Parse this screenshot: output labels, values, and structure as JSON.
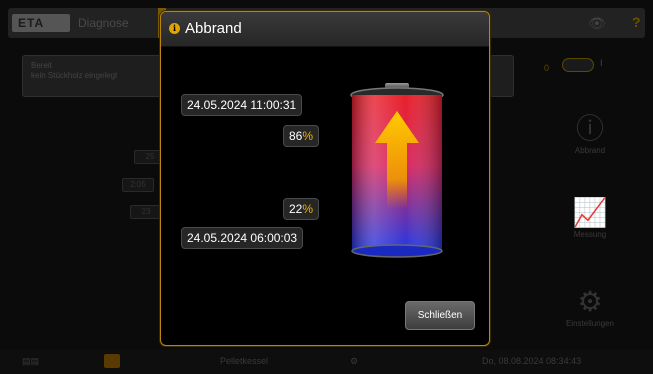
{
  "background": {
    "logo_text": "ETA",
    "tab_diagnose": "Diagnose",
    "status_line1": "Bereit",
    "status_line2": "kein Stückholz eingelegt",
    "toggle_left": "0",
    "toggle_right": "I",
    "cells": [
      "25",
      "2:05",
      "23"
    ],
    "side_items": [
      {
        "label": "Abbrand",
        "icon": "info-icon"
      },
      {
        "label": "Messung",
        "icon": "chart-icon"
      },
      {
        "label": "Einstellungen",
        "icon": "gears-icon"
      }
    ],
    "bottom_middle": "Pelletkessel",
    "bottom_datetime": "Do, 08.08.2024 08:34:43"
  },
  "dialog": {
    "title": "Abbrand",
    "start_time": "24.05.2024 11:00:31",
    "start_percent": "86",
    "end_percent": "22",
    "end_time": "24.05.2024 06:00:03",
    "percent_sign": "%",
    "close_label": "Schließen"
  },
  "colors": {
    "accent": "#f0b400",
    "dialog_border": "#b8860b",
    "battery_top": "#e8202a",
    "battery_bottom": "#1f38e8",
    "arrow": "#f5b400"
  }
}
